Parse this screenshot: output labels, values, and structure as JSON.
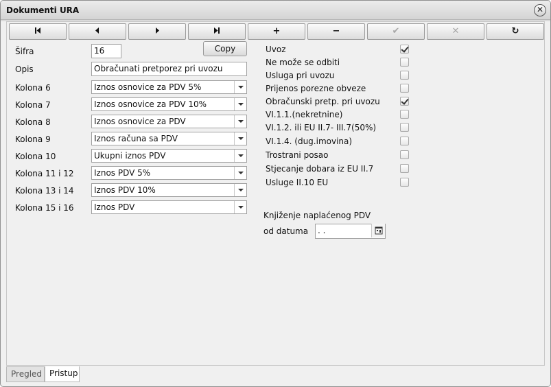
{
  "window": {
    "title": "Dokumenti URA",
    "close_glyph": "✕"
  },
  "toolbar": {
    "first": "first-icon",
    "prev": "prev-icon",
    "next": "next-icon",
    "last": "last-icon",
    "add": "+",
    "remove": "−",
    "confirm": "✔",
    "cancel": "✕",
    "refresh": "↻"
  },
  "form": {
    "sifra_label": "Šifra",
    "sifra_value": "16",
    "copy_label": "Copy",
    "opis_label": "Opis",
    "opis_value": "Obračunati pretporez pri uvozu",
    "kolone": [
      {
        "label": "Kolona 6",
        "value": "Iznos osnovice za PDV 5%"
      },
      {
        "label": "Kolona 7",
        "value": "Iznos osnovice za PDV 10%"
      },
      {
        "label": "Kolona 8",
        "value": "Iznos osnovice za PDV"
      },
      {
        "label": "Kolona 9",
        "value": "Iznos računa sa PDV"
      },
      {
        "label": "Kolona 10",
        "value": "Ukupni iznos PDV"
      },
      {
        "label": "Kolona 11 i 12",
        "value": "Iznos PDV 5%"
      },
      {
        "label": "Kolona 13 i 14",
        "value": "Iznos PDV 10%"
      },
      {
        "label": "Kolona 15 i 16",
        "value": "Iznos PDV"
      }
    ]
  },
  "options": [
    {
      "label": "Uvoz",
      "checked": true
    },
    {
      "label": "Ne može se odbiti",
      "checked": false
    },
    {
      "label": "Usluga pri uvozu",
      "checked": false
    },
    {
      "label": "Prijenos porezne obveze",
      "checked": false
    },
    {
      "label": "Obračunski pretp. pri uvozu",
      "checked": true
    },
    {
      "label": "VI.1.1.(nekretnine)",
      "checked": false
    },
    {
      "label": "VI.1.2.  ili EU II.7- III.7(50%)",
      "checked": false
    },
    {
      "label": "VI.1.4. (dug.imovina)",
      "checked": false
    },
    {
      "label": "Trostrani posao",
      "checked": false
    },
    {
      "label": "Stjecanje dobara iz EU II.7",
      "checked": false
    },
    {
      "label": "Usluge II.10 EU",
      "checked": false
    }
  ],
  "booking": {
    "title": "Knjiženje naplaćenog PDV",
    "date_label": "od datuma",
    "date_value": " .  ."
  },
  "tabs": [
    {
      "label": "Pregled",
      "active": false
    },
    {
      "label": "Pristup",
      "active": true
    }
  ]
}
